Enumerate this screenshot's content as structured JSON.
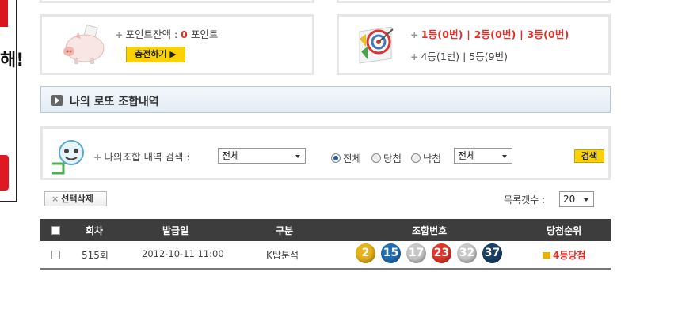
{
  "banner": {
    "text": "해!"
  },
  "points": {
    "label": "포인트잔액 :",
    "value": "0",
    "unit": "포인트",
    "charge_button": "충전하기 ▶"
  },
  "ranks": {
    "line1": "1등(0번) | 2등(0번) | 3등(0번)",
    "line2": "4등(1번) | 5등(9번)"
  },
  "section": {
    "title": "나의 로또 조합내역"
  },
  "search": {
    "label": "나의조합 내역 검색 :",
    "select1": "전체",
    "radios": [
      {
        "label": "전체",
        "checked": true
      },
      {
        "label": "당첨",
        "checked": false
      },
      {
        "label": "낙첨",
        "checked": false
      }
    ],
    "select2": "전체",
    "button": "검색"
  },
  "list_controls": {
    "delete_button": "선택삭제",
    "count_label": "목록갯수 :",
    "count_value": "20"
  },
  "table": {
    "headers": [
      "회차",
      "발급일",
      "구분",
      "조합번호",
      "당첨순위"
    ],
    "rows": [
      {
        "round": "515회",
        "date": "2012-10-11 11:00",
        "type": "K탑분석",
        "balls": [
          {
            "num": "2",
            "color": "#e8b21a"
          },
          {
            "num": "15",
            "color": "#1f6fb5"
          },
          {
            "num": "17",
            "color": "#c8c8c8"
          },
          {
            "num": "23",
            "color": "#e2362b"
          },
          {
            "num": "32",
            "color": "#c8c8c8"
          },
          {
            "num": "37",
            "color": "#1b3f66"
          }
        ],
        "rank": "4등당첨"
      }
    ]
  }
}
